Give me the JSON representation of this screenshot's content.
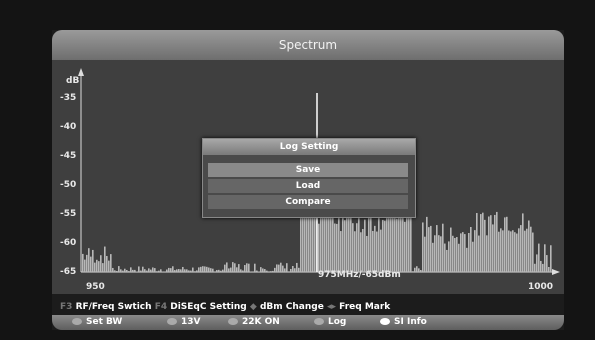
{
  "window": {
    "title": "Spectrum"
  },
  "axis": {
    "y_unit": "dB",
    "y_ticks": [
      "-35",
      "-40",
      "-45",
      "-50",
      "-55",
      "-60",
      "-65"
    ],
    "x_start": "950",
    "x_end": "1000"
  },
  "marker": {
    "readout": "975MHz/-65dBm"
  },
  "dialog": {
    "title": "Log Setting",
    "items": [
      {
        "label": "Save",
        "selected": true
      },
      {
        "label": "Load",
        "selected": false
      },
      {
        "label": "Compare",
        "selected": false
      }
    ]
  },
  "help": [
    {
      "key": "F3",
      "label": "RF/Freq Swtich"
    },
    {
      "key": "F4",
      "label": "DiSEqC Setting"
    },
    {
      "key": "◆",
      "label": "dBm Change"
    },
    {
      "key": "◂▸",
      "label": "Freq Mark"
    }
  ],
  "buttons": [
    {
      "label": "Set BW",
      "color": "#aaaaaa"
    },
    {
      "label": "13V",
      "color": "#aaaaaa"
    },
    {
      "label": "22K ON",
      "color": "#aaaaaa"
    },
    {
      "label": "Log",
      "color": "#aaaaaa"
    },
    {
      "label": "SI Info",
      "color": "#ffffff"
    }
  ],
  "chart_data": {
    "type": "bar",
    "xlim": [
      950,
      1000
    ],
    "ylim": [
      -65,
      -33
    ],
    "marker_x": 975
  }
}
